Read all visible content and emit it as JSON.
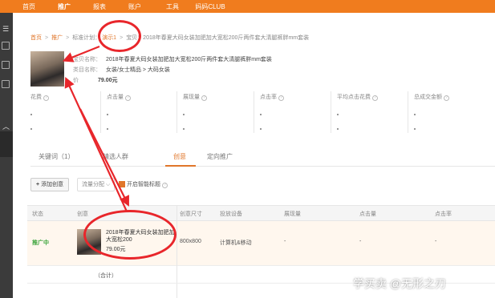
{
  "topnav": {
    "items": [
      "首页",
      "推广",
      "报表",
      "账户",
      "工具",
      "妈妈CLUB"
    ],
    "active_index": 1
  },
  "breadcrumb": {
    "items": [
      "首页",
      "推广",
      "标准计划：",
      "演示1",
      "宝贝：2018年春夏大码女装加肥加大宽松200斤两件套大清腿裤胖mm套装"
    ]
  },
  "product": {
    "name_label": "宝贝名称：",
    "name_value": "2018年春夏大码女装加肥加大宽松200斤两件套大清腿裤胖mm套装",
    "category_label": "类目名称：",
    "category_value": "女装/女士精品 > 大码女装",
    "price_label": "价",
    "price_value": "79.00元"
  },
  "metrics": [
    {
      "label": "花费",
      "value": "-"
    },
    {
      "label": "点击量",
      "value": "-"
    },
    {
      "label": "展现量",
      "value": "-"
    },
    {
      "label": "点击率",
      "value": "-"
    },
    {
      "label": "平均点击花费",
      "value": "-"
    },
    {
      "label": "总成交金额",
      "value": "-"
    }
  ],
  "tabs": [
    {
      "label": "关键词（1）"
    },
    {
      "label": "精选人群"
    },
    {
      "label": "创意"
    },
    {
      "label": "定向推广"
    }
  ],
  "active_tab": 2,
  "toolbar": {
    "add_label": "添加创意",
    "select_label": "流量分配",
    "smart_label": "开启智能标题"
  },
  "table": {
    "headers": [
      "状态",
      "创意",
      "创意尺寸",
      "投放设备",
      "展现量",
      "点击量",
      "点击率"
    ],
    "row": {
      "status": "推广中",
      "title": "2018年春夏大码女装加肥加大宽松200",
      "price": "79.00元",
      "size": "800x800",
      "device": "计算机&移动",
      "impressions": "-",
      "clicks": "-",
      "ctr": "-"
    },
    "total_label": "（合计）"
  },
  "watermark": "学买卖 @无形之刃",
  "colors": {
    "brand_orange": "#f07c1e",
    "annotation_red": "#e8262b",
    "status_green": "#3aa33a"
  }
}
